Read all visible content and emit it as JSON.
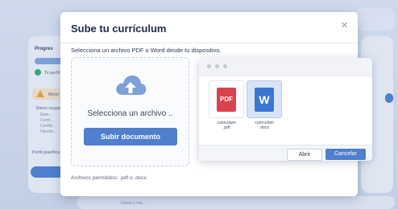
{
  "background": {
    "progress_label": "Progres",
    "item_1": "Tu perfil",
    "warning_label": "Mejor",
    "list_heading": "Datos cargados",
    "list_items": [
      "Nom...",
      "Certif...",
      "Certific...",
      "Harsim..."
    ],
    "profile_label": "Perfil planifica",
    "bottom_label": "Datos y rela..."
  },
  "modal": {
    "title": "Sube tu currículum",
    "subtitle": "Selecciona un archivo PDF o Word desde tu dispositivo.",
    "dropzone_label": "Selecciona un archivo ..",
    "upload_button": "Subir documento",
    "allowed_formats": "Archivos permitidos: .pdf o .docx"
  },
  "file_picker": {
    "files": [
      {
        "icon_text": "PDF",
        "name_line1": "currículum",
        "name_line2": ".pdf",
        "selected": false
      },
      {
        "icon_text": "W",
        "name_line1": "currículum",
        "name_line2": ".docx",
        "selected": true
      }
    ],
    "open_button": "Abrir",
    "cancel_button": "Cancelar"
  },
  "colors": {
    "accent": "#4f7fcd",
    "pdf": "#d9434f",
    "word": "#3b76d2"
  }
}
